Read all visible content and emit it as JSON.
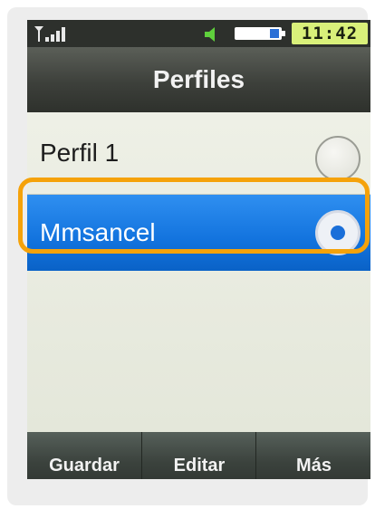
{
  "status_bar": {
    "signal_icon": "signal-strength-icon",
    "sound_icon": "speaker-icon",
    "battery_icon": "battery-icon",
    "time": "11:42",
    "clock_color": "#d9f07a"
  },
  "header": {
    "title": "Perfiles"
  },
  "profiles": [
    {
      "label": "Perfil 1",
      "selected": false
    },
    {
      "label": "Mmsancel",
      "selected": true
    }
  ],
  "softkeys": {
    "left": "Guardar",
    "center": "Editar",
    "right": "Más"
  },
  "colors": {
    "selection": "#1273de",
    "highlight_outline": "#f5a20a"
  }
}
